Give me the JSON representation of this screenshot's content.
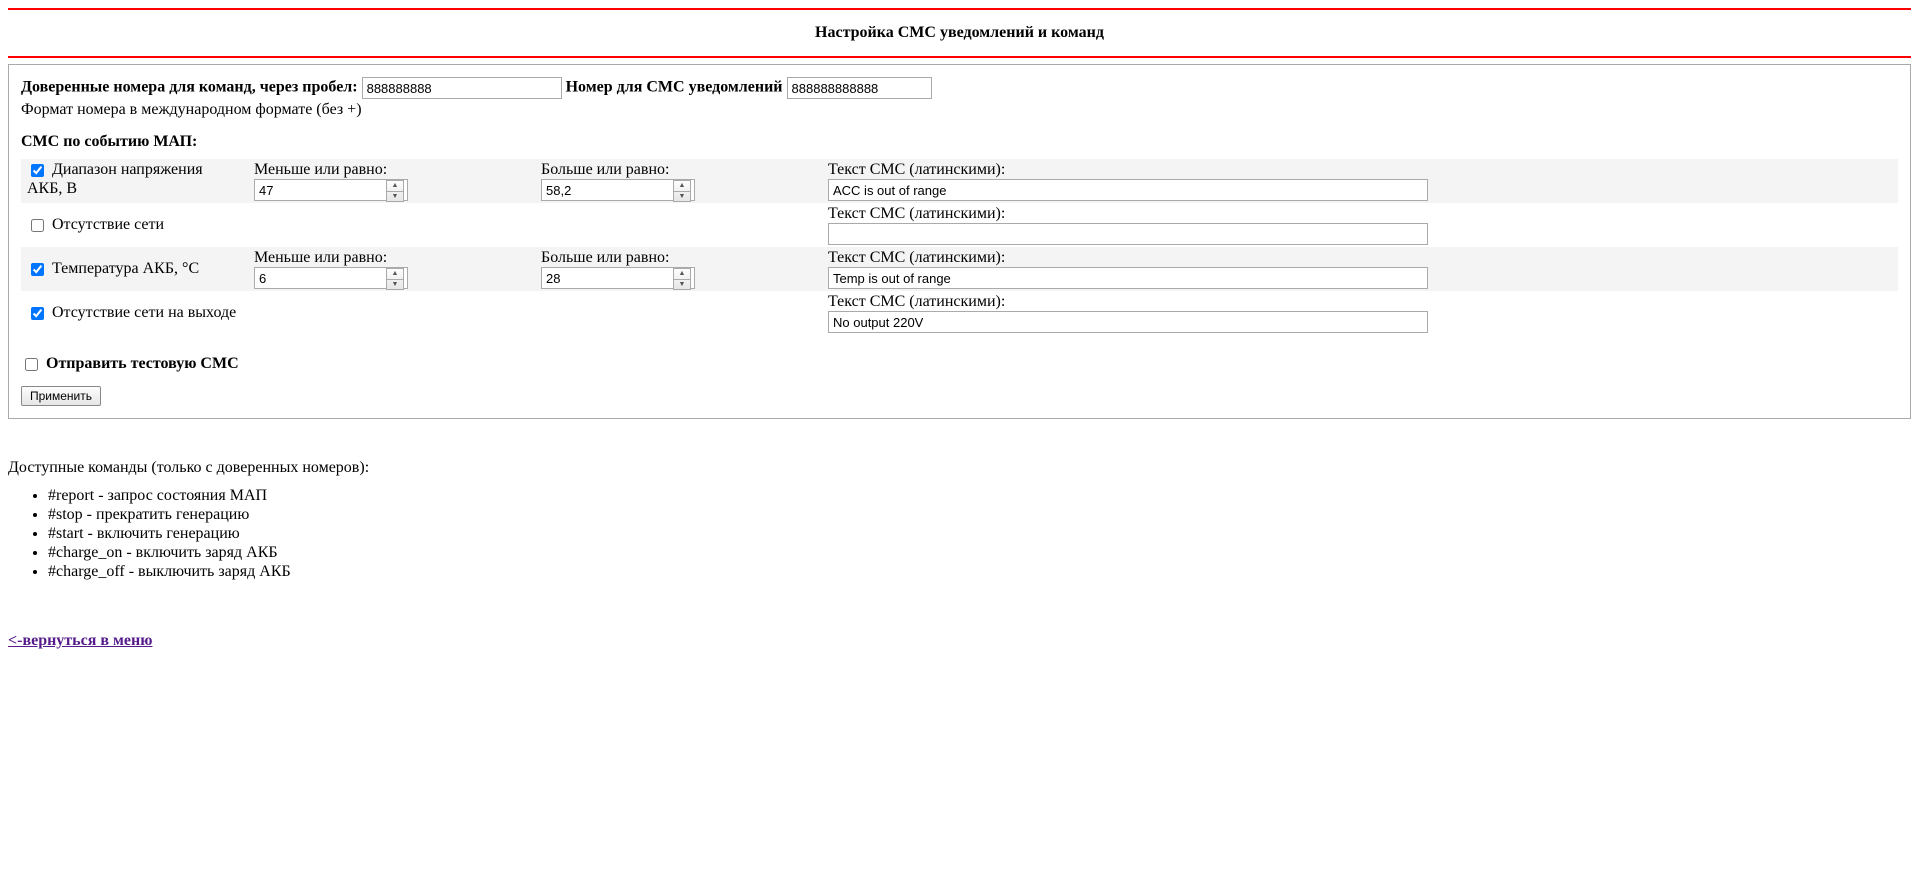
{
  "title": "Настройка СМС уведомлений и команд",
  "trusted": {
    "label": "Доверенные номера для команд, через пробел:",
    "value": "888888888"
  },
  "notify": {
    "label": "Номер для СМС уведомлений",
    "value": "888888888888"
  },
  "format_note": "Формат номера в международном формате (без +)",
  "event_header": "СМС по событию МАП:",
  "cols": {
    "le": "Меньше или равно:",
    "ge": "Больше или равно:",
    "sms": "Текст СМС (латинскими):"
  },
  "rows": {
    "r1": {
      "checked": true,
      "name": "Диапазон напряжения АКБ, В",
      "le": "47",
      "ge": "58,2",
      "sms": "ACC is out of range"
    },
    "r2": {
      "checked": false,
      "name": "Отсутствие сети",
      "le": "",
      "ge": "",
      "sms": ""
    },
    "r3": {
      "checked": true,
      "name": "Температура АКБ, °C",
      "le": "6",
      "ge": "28",
      "sms": "Temp is out of range"
    },
    "r4": {
      "checked": true,
      "name": "Отсутствие сети на выходе",
      "le": "",
      "ge": "",
      "sms": "No output 220V"
    }
  },
  "test_sms": {
    "checked": false,
    "label": "Отправить тестовую СМС"
  },
  "apply_label": "Применить",
  "commands": {
    "header": "Доступные команды (только с доверенных номеров):",
    "items": [
      "#report - запрос состояния МАП",
      "#stop - прекратить генерацию",
      "#start - включить генерацию",
      "#charge_on - включить заряд АКБ",
      "#charge_off - выключить заряд АКБ"
    ]
  },
  "back_link": "<-вернуться в меню"
}
